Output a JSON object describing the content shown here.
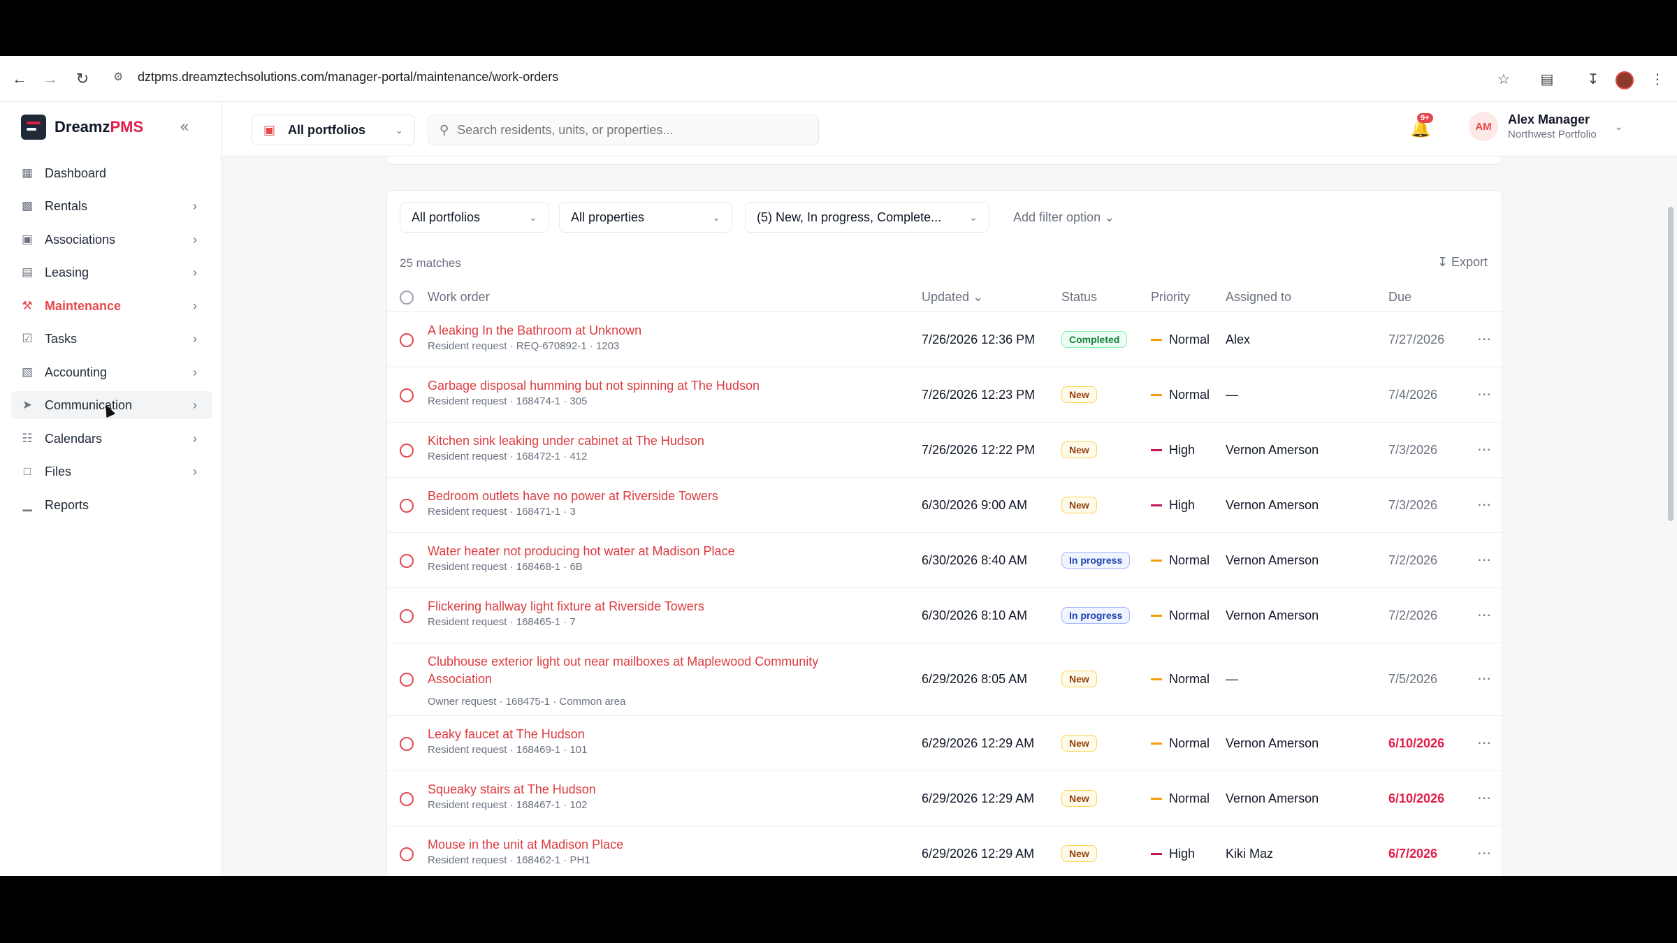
{
  "browser": {
    "url": "dztpms.dreamztechsolutions.com/manager-portal/maintenance/work-orders"
  },
  "app": {
    "logo_main": "Dreamz",
    "logo_accent": "PMS",
    "accent_color": "#e5484d"
  },
  "sidebar": {
    "items": [
      {
        "label": "Dashboard",
        "icon": "grid-icon"
      },
      {
        "label": "Rentals",
        "icon": "building-icon"
      },
      {
        "label": "Associations",
        "icon": "bank-icon"
      },
      {
        "label": "Leasing",
        "icon": "document-icon"
      },
      {
        "label": "Maintenance",
        "icon": "wrench-icon"
      },
      {
        "label": "Tasks",
        "icon": "checkbox-icon"
      },
      {
        "label": "Accounting",
        "icon": "wallet-icon"
      },
      {
        "label": "Communication",
        "icon": "send-icon"
      },
      {
        "label": "Calendars",
        "icon": "calendar-icon"
      },
      {
        "label": "Files",
        "icon": "folder-icon"
      },
      {
        "label": "Reports",
        "icon": "bar-chart-icon"
      }
    ]
  },
  "topbar": {
    "portfolio": "All portfolios",
    "search_placeholder": "Search residents, units, or properties...",
    "notification_badge": "9+",
    "user_initials": "AM",
    "user_name": "Alex Manager",
    "user_portfolio": "Northwest Portfolio"
  },
  "filters": {
    "portfolios": "All portfolios",
    "properties": "All properties",
    "status": "(5) New, In progress, Complete...",
    "add": "Add filter option"
  },
  "list": {
    "matches": "25 matches",
    "export": "Export",
    "columns": {
      "work_order": "Work order",
      "updated": "Updated",
      "status": "Status",
      "priority": "Priority",
      "assigned": "Assigned to",
      "due": "Due"
    },
    "rows": [
      {
        "title": "A leaking In the Bathroom at Unknown",
        "sub": "Resident request · REQ-670892-1 · 1203",
        "updated": "7/26/2026 12:36 PM",
        "status": "Completed",
        "priority": "Normal",
        "assigned": "Alex",
        "due": "7/27/2026"
      },
      {
        "title": "Garbage disposal humming but not spinning at The Hudson",
        "sub": "Resident request · 168474-1 · 305",
        "updated": "7/26/2026 12:23 PM",
        "status": "New",
        "priority": "Normal",
        "assigned": "—",
        "due": "7/4/2026"
      },
      {
        "title": "Kitchen sink leaking under cabinet at The Hudson",
        "sub": "Resident request · 168472-1 · 412",
        "updated": "7/26/2026 12:22 PM",
        "status": "New",
        "priority": "High",
        "assigned": "Vernon Amerson",
        "due": "7/3/2026"
      },
      {
        "title": "Bedroom outlets have no power at Riverside Towers",
        "sub": "Resident request · 168471-1 · 3",
        "updated": "6/30/2026 9:00 AM",
        "status": "New",
        "priority": "High",
        "assigned": "Vernon Amerson",
        "due": "7/3/2026"
      },
      {
        "title": "Water heater not producing hot water at Madison Place",
        "sub": "Resident request · 168468-1 · 6B",
        "updated": "6/30/2026 8:40 AM",
        "status": "In progress",
        "priority": "Normal",
        "assigned": "Vernon Amerson",
        "due": "7/2/2026"
      },
      {
        "title": "Flickering hallway light fixture at Riverside Towers",
        "sub": "Resident request · 168465-1 · 7",
        "updated": "6/30/2026 8:10 AM",
        "status": "In progress",
        "priority": "Normal",
        "assigned": "Vernon Amerson",
        "due": "7/2/2026"
      },
      {
        "title": "Clubhouse exterior light out near mailboxes at Maplewood Community Association",
        "sub": "Owner request · 168475-1 · Common area",
        "updated": "6/29/2026 8:05 AM",
        "status": "New",
        "priority": "Normal",
        "assigned": "—",
        "due": "7/5/2026"
      },
      {
        "title": "Leaky faucet at The Hudson",
        "sub": "Resident request · 168469-1 · 101",
        "updated": "6/29/2026 12:29 AM",
        "status": "New",
        "priority": "Normal",
        "assigned": "Vernon Amerson",
        "due": "6/10/2026"
      },
      {
        "title": "Squeaky stairs at The Hudson",
        "sub": "Resident request · 168467-1 · 102",
        "updated": "6/29/2026 12:29 AM",
        "status": "New",
        "priority": "Normal",
        "assigned": "Vernon Amerson",
        "due": "6/10/2026"
      },
      {
        "title": "Mouse in the unit at Madison Place",
        "sub": "Resident request · 168462-1 · PH1",
        "updated": "6/29/2026 12:29 AM",
        "status": "New",
        "priority": "High",
        "assigned": "Kiki Maz",
        "due": "6/7/2026"
      }
    ]
  }
}
